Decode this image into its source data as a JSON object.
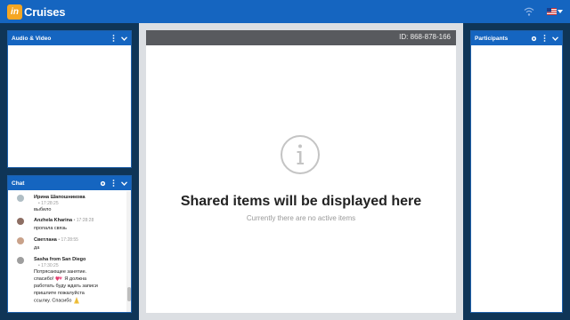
{
  "app": {
    "logo_badge": "in",
    "logo_name": "Cruises"
  },
  "topbar": {
    "icons": [
      "wifi-icon",
      "us-flag-icon",
      "chevron-down-icon"
    ]
  },
  "audio_video": {
    "title": "Audio & Video"
  },
  "chat": {
    "title": "Chat",
    "messages": [
      {
        "name": "Ирина Шапошникова",
        "time": "17:28:25",
        "text": "выбило"
      },
      {
        "name": "Anzhela Kharina",
        "time": "17:28:28",
        "text": "пропала связь"
      },
      {
        "name": "Светлана",
        "time": "17:28:55",
        "text": "да"
      },
      {
        "name": "Sasha from San Diego",
        "time": "17:30:25",
        "text_lines": [
          "Потрясающее занятие.",
          "спасибо!",
          "Я должна",
          "работать буду ждать записи",
          "пришлите пожалуйста",
          "ссылку. Спасибо"
        ]
      }
    ]
  },
  "participants": {
    "title": "Participants"
  },
  "share": {
    "meeting_id": "ID: 868-878-166",
    "title": "Shared items will be displayed here",
    "subtitle": "Currently there are no active items"
  },
  "colors": {
    "topbar": "#1565c0",
    "background": "#0f3557",
    "accent": "#f5a623"
  }
}
